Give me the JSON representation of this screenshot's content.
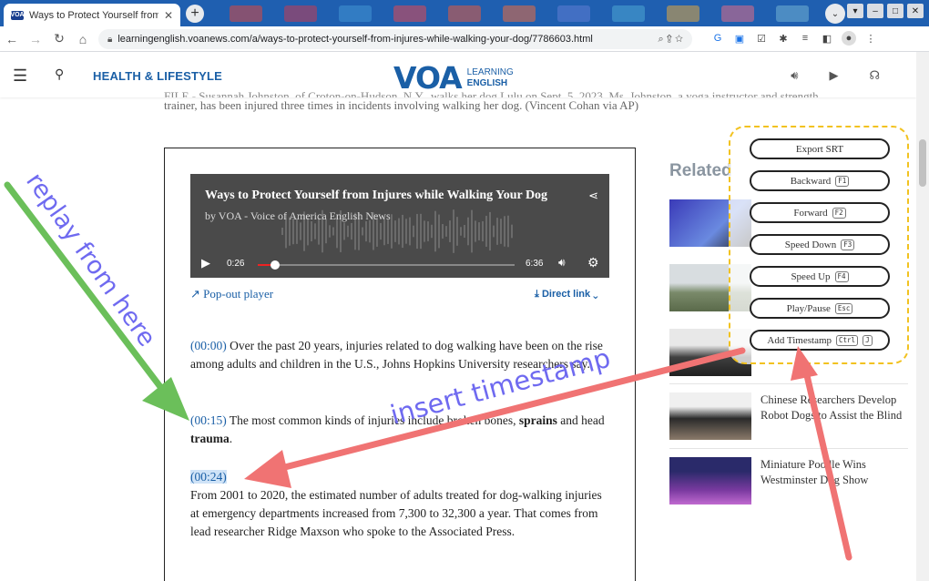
{
  "browser": {
    "tab_title": "Ways to Protect Yourself from Inj",
    "tab_favicon": "VOA",
    "url": "learningenglish.voanews.com/a/ways-to-protect-yourself-from-injures-while-walking-your-dog/7786603.html"
  },
  "site": {
    "section": "HEALTH & LIFESTYLE",
    "logo_main": "VOA",
    "logo_line1": "LEARNING",
    "logo_line2": "ENGLISH"
  },
  "article": {
    "caption_line1": "FILE - Susannah Johnston, of Croton-on-Hudson, N.Y., walks her dog Lulu on Sept. 5, 2023. Ms. Johnston, a yoga instructor and strength",
    "caption_line2": "trainer, has been injured three times in incidents involving walking her dog. (Vincent Cohan via AP)",
    "player_title": "Ways to Protect Yourself from Injures while Walking Your Dog",
    "player_by": "by VOA - Voice of America English News",
    "time_current": "0:26",
    "time_duration": "6:36",
    "progress_fraction": 0.066,
    "popout_label": "Pop-out player",
    "direct_link_label": "Direct link",
    "paragraphs": [
      {
        "ts": "(00:00)",
        "pre": " Over the past 20 years, injuries related to dog walking have been on the rise among adults and children in the U.S., Johns Hopkins University researchers say."
      },
      {
        "ts": "(00:15)",
        "pre": " The most common kinds of injuries include broken bones, ",
        "b1": "sprains",
        "mid": " and head ",
        "b2": "trauma",
        "post": "."
      },
      {
        "ts": "(00:24)",
        "pre": "From 2001 to 2020, the estimated number of adults treated for dog-walking injuries at emergency departments increased from 7,300 to 32,300 a year. That comes from lead researcher Ridge Maxson who spoke to the Associated Press."
      }
    ]
  },
  "related": {
    "heading": "Related",
    "items": [
      {
        "title": "Chinese Researchers Develop Robot Dogs to Assist the Blind"
      },
      {
        "title": "Miniature Poodle Wins Westminster Dog Show"
      }
    ]
  },
  "extension": {
    "buttons": [
      {
        "label": "Export SRT",
        "keys": []
      },
      {
        "label": "Backward",
        "keys": [
          "F1"
        ]
      },
      {
        "label": "Forward",
        "keys": [
          "F2"
        ]
      },
      {
        "label": "Speed Down",
        "keys": [
          "F3"
        ]
      },
      {
        "label": "Speed Up",
        "keys": [
          "F4"
        ]
      },
      {
        "label": "Play/Pause",
        "keys": [
          "Esc"
        ]
      },
      {
        "label": "Add Timestamp",
        "keys": [
          "Ctrl",
          "J"
        ]
      }
    ]
  },
  "annotations": {
    "replay": "replay from here",
    "insert": "insert timestamp"
  },
  "colors": {
    "accent": "#1a5fa6",
    "chrome_blue": "#1f5fb0",
    "highlight": "#f2c220",
    "arrow_green": "#6bbf5a",
    "arrow_red": "#f07373",
    "annotation_text": "#6f6af0"
  }
}
